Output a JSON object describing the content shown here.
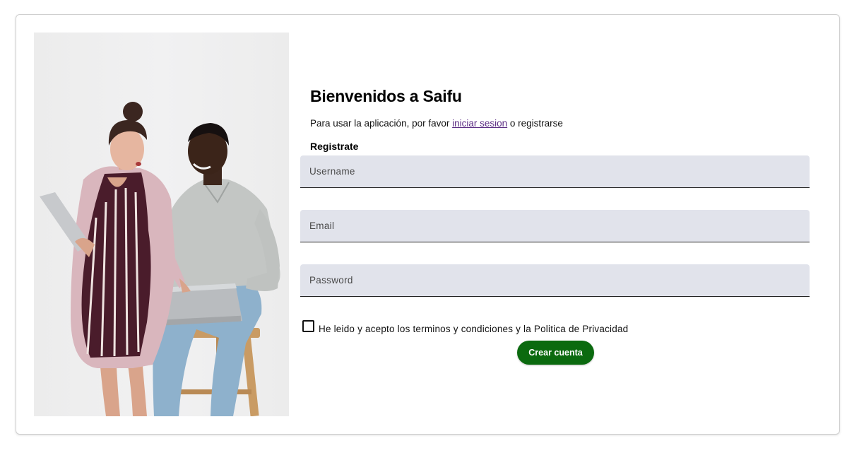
{
  "page": {
    "title": "Bienvenidos a Saifu",
    "subtitle_before": "Para usar la aplicación, por favor ",
    "login_link": "iniciar sesion",
    "subtitle_after": " o registrarse",
    "section_label": "Registrate"
  },
  "form": {
    "username": {
      "placeholder": "Username",
      "value": ""
    },
    "email": {
      "placeholder": "Email",
      "value": ""
    },
    "password": {
      "placeholder": "Password",
      "value": ""
    },
    "terms_label": "He leido y acepto los terminos y condiciones y la Politica de Privacidad",
    "terms_checked": false,
    "submit_label": "Crear cuenta"
  },
  "colors": {
    "accent": "#0b6a0f",
    "link": "#5b2c83",
    "field_background": "#e1e3eb"
  },
  "hero_image": {
    "description": "two-people-with-laptop-photo"
  }
}
